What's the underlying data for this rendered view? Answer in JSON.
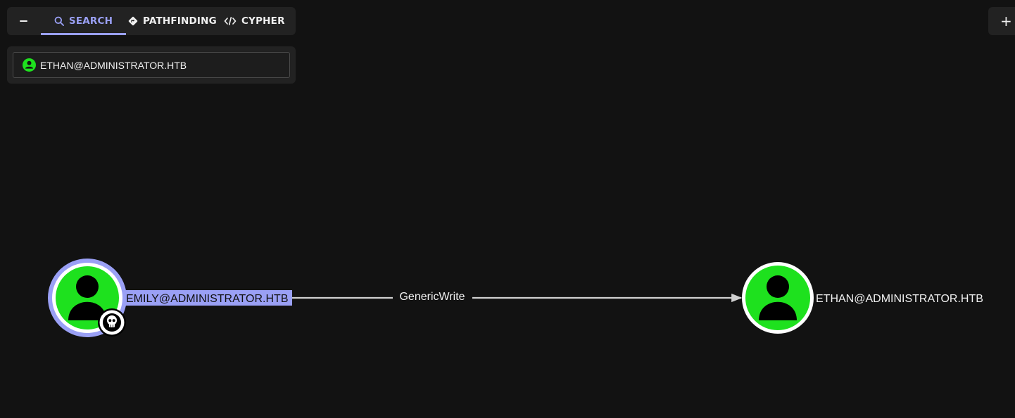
{
  "toolbar": {
    "collapse_icon": "minus-icon",
    "tabs": [
      {
        "label": "SEARCH",
        "icon": "search-icon",
        "active": true
      },
      {
        "label": "PATHFINDING",
        "icon": "diamond-direction-icon",
        "active": false
      },
      {
        "label": "CYPHER",
        "icon": "code-icon",
        "active": false
      }
    ],
    "accent_color": "#9aa0f5"
  },
  "search": {
    "value": "ETHAN@ADMINISTRATOR.HTB",
    "icon": "user-circle-icon"
  },
  "add_button": {
    "label": "+",
    "icon": "plus-icon"
  },
  "graph": {
    "nodes": [
      {
        "id": "emily",
        "label": "EMILY@ADMINISTRATOR.HTB",
        "type": "user",
        "selected": true,
        "badge": "skull-icon",
        "fill": "#1ee11e",
        "highlight": "#9aa0f5"
      },
      {
        "id": "ethan",
        "label": "ETHAN@ADMINISTRATOR.HTB",
        "type": "user",
        "selected": false,
        "fill": "#1ee11e"
      }
    ],
    "edges": [
      {
        "source": "emily",
        "target": "ethan",
        "label": "GenericWrite"
      }
    ]
  }
}
